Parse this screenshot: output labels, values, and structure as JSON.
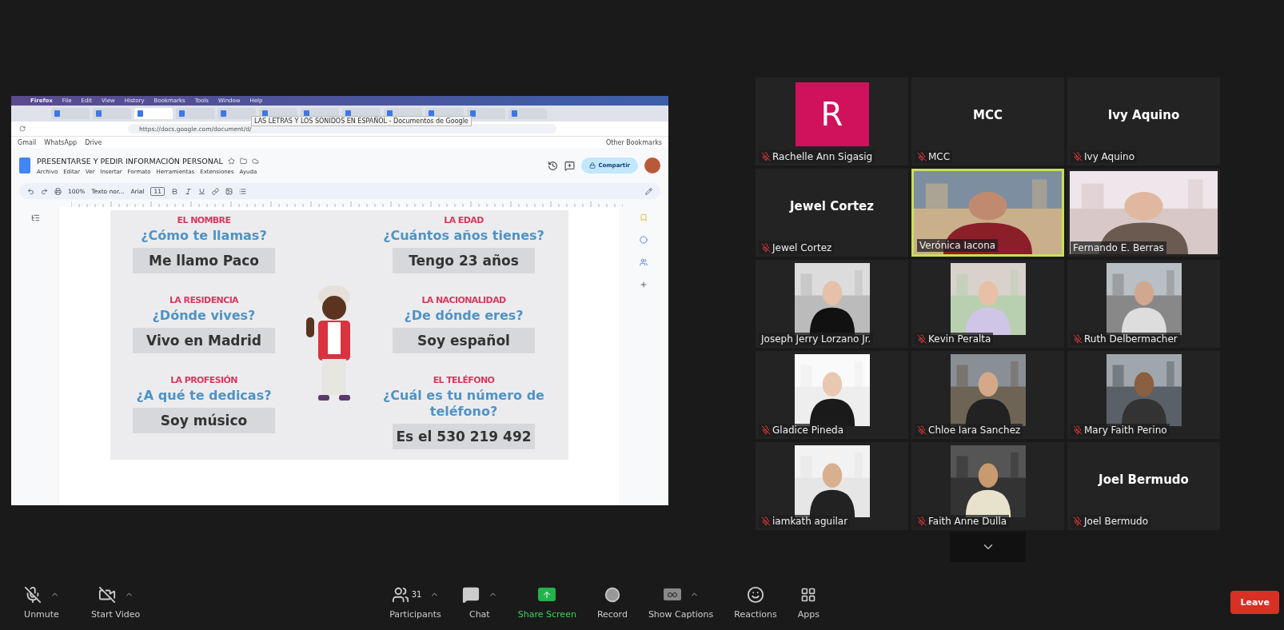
{
  "shared_screen": {
    "menu_bar": [
      "Firefox",
      "File",
      "Edit",
      "View",
      "History",
      "Bookmarks",
      "Tools",
      "Window",
      "Help"
    ],
    "tabs": [
      {
        "selected": false
      },
      {
        "selected": false
      },
      {
        "selected": true
      },
      {
        "selected": false
      },
      {
        "selected": false
      },
      {
        "selected": false
      },
      {
        "selected": false
      },
      {
        "selected": false
      },
      {
        "selected": false
      },
      {
        "selected": false
      },
      {
        "selected": false
      },
      {
        "selected": false
      }
    ],
    "tooltip": "LAS LETRAS Y LOS SONIDOS EN ESPAÑOL - Documentos de Google",
    "address": "https://docs.google.com/document/d/",
    "bookmarks": [
      "Gmail",
      "WhatsApp",
      "Drive"
    ],
    "other_bookmarks": "Other Bookmarks",
    "doc": {
      "title": "PRESENTARSE Y PEDIR INFORMACIÓN PERSONAL",
      "menu": [
        "Archivo",
        "Editar",
        "Ver",
        "Insertar",
        "Formato",
        "Herramientas",
        "Extensiones",
        "Ayuda"
      ],
      "share": "Compartir",
      "zoom": "100%",
      "style": "Texto nor...",
      "font": "Arial",
      "size": "11"
    },
    "slide": {
      "left": [
        {
          "heading": "EL NOMBRE",
          "question": "¿Cómo te llamas?",
          "answer": "Me llamo Paco"
        },
        {
          "heading": "LA RESIDENCIA",
          "question": "¿Dónde vives?",
          "answer": "Vivo en Madrid"
        },
        {
          "heading": "LA PROFESIÓN",
          "question": "¿A qué te dedicas?",
          "answer": "Soy músico"
        }
      ],
      "right": [
        {
          "heading": "LA EDAD",
          "question": "¿Cuántos años tienes?",
          "answer": "Tengo 23 años"
        },
        {
          "heading": "LA NACIONALIDAD",
          "question": "¿De dónde eres?",
          "answer": "Soy español"
        },
        {
          "heading": "EL TELÉFONO",
          "question": "¿Cuál es tu número de teléfono?",
          "answer": "Es el 530 219 492"
        }
      ]
    }
  },
  "participants": [
    {
      "name": "Rachelle Ann Sigasig",
      "kind": "avatar",
      "initial": "R",
      "muted": true,
      "speaking": false
    },
    {
      "name": "MCC",
      "kind": "name",
      "big_name": "MCC",
      "muted": true,
      "speaking": false
    },
    {
      "name": "Ivy Aquino",
      "kind": "name",
      "big_name": "Ivy Aquino",
      "muted": true,
      "speaking": false
    },
    {
      "name": "Jewel Cortez",
      "kind": "name",
      "big_name": "Jewel Cortez",
      "muted": true,
      "speaking": false
    },
    {
      "name": "Verónica Iacona",
      "kind": "video",
      "muted": false,
      "speaking": true
    },
    {
      "name": "Fernando E. Berras",
      "kind": "video",
      "muted": false,
      "speaking": false
    },
    {
      "name": "Joseph Jerry Lorzano Jr.",
      "kind": "portrait",
      "muted": false,
      "speaking": false
    },
    {
      "name": "Kevin Peralta",
      "kind": "portrait",
      "muted": true,
      "speaking": false
    },
    {
      "name": "Ruth Delbermacher",
      "kind": "portrait",
      "muted": true,
      "speaking": false
    },
    {
      "name": "Gladice Pineda",
      "kind": "portrait",
      "muted": true,
      "speaking": false
    },
    {
      "name": "Chloe Iara Sanchez",
      "kind": "portrait",
      "muted": true,
      "speaking": false
    },
    {
      "name": "Mary Faith Perino",
      "kind": "portrait",
      "muted": true,
      "speaking": false
    },
    {
      "name": "iamkath aguilar",
      "kind": "portrait",
      "muted": true,
      "speaking": false
    },
    {
      "name": "Faith Anne Dulla",
      "kind": "portrait",
      "muted": true,
      "speaking": false
    },
    {
      "name": "Joel Bermudo",
      "kind": "name",
      "big_name": "Joel Bermudo",
      "muted": true,
      "speaking": false
    }
  ],
  "toolbar": {
    "items": [
      {
        "kind": "mic",
        "label": "Unmute",
        "caret": true
      },
      {
        "kind": "video",
        "label": "Start Video",
        "caret": true
      },
      {
        "kind": "participants",
        "label": "Participants",
        "count": "31",
        "caret": true
      },
      {
        "kind": "chat",
        "label": "Chat",
        "caret": true
      },
      {
        "kind": "share",
        "label": "Share Screen",
        "caret": false
      },
      {
        "kind": "record",
        "label": "Record",
        "caret": false
      },
      {
        "kind": "captions",
        "label": "Show Captions",
        "caret": true
      },
      {
        "kind": "reactions",
        "label": "Reactions",
        "caret": false
      },
      {
        "kind": "apps",
        "label": "Apps",
        "caret": false
      }
    ],
    "leave": "Leave"
  }
}
